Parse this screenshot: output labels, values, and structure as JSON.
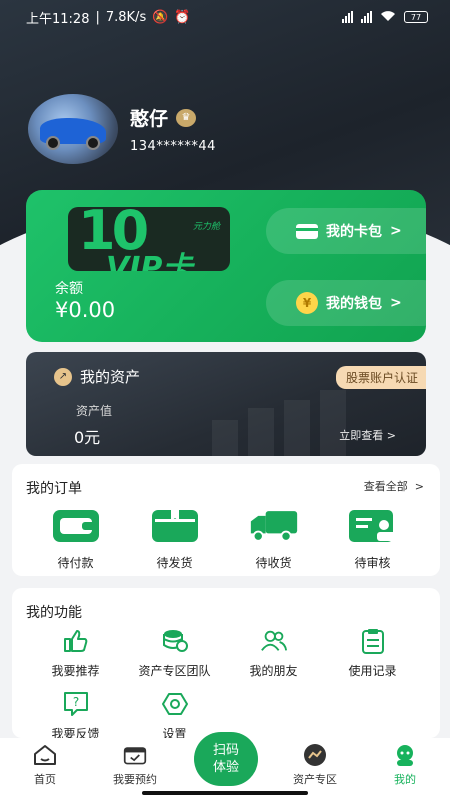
{
  "status_bar": {
    "time": "上午11:28",
    "speed": "7.8K/s",
    "network1": "4G",
    "network2": "4G",
    "battery": "77"
  },
  "profile": {
    "username": "憨仔",
    "phone": "134******44",
    "avatar_icon": "car-photo-avatar",
    "badge_icon": "vip-badge-icon"
  },
  "green_card": {
    "vip_big": "10",
    "vip_word": "VIP卡",
    "vip_brand": "元力舱",
    "balance_label": "余额",
    "balance_value": "¥0.00",
    "card_pack_label": "我的卡包",
    "wallet_label": "我的钱包",
    "coin_symbol": "¥",
    "arrow": ">"
  },
  "assets": {
    "title": "我的资产",
    "stock_tag": "股票账户认证",
    "value_label": "资产值",
    "value": "0元",
    "view_now": "立即查看 >"
  },
  "orders": {
    "title": "我的订单",
    "see_all": "查看全部",
    "see_all_arrow": ">",
    "items": [
      {
        "label": "待付款",
        "icon": "wallet-icon"
      },
      {
        "label": "待发货",
        "icon": "package-icon"
      },
      {
        "label": "待收货",
        "icon": "truck-icon"
      },
      {
        "label": "待审核",
        "icon": "id-card-icon"
      }
    ]
  },
  "functions": {
    "title": "我的功能",
    "items": [
      {
        "label": "我要推荐",
        "icon": "thumbs-up-icon"
      },
      {
        "label": "资产专区团队",
        "icon": "coins-icon"
      },
      {
        "label": "我的朋友",
        "icon": "friends-icon"
      },
      {
        "label": "使用记录",
        "icon": "clipboard-icon"
      },
      {
        "label": "我要反馈",
        "icon": "feedback-icon"
      },
      {
        "label": "设置",
        "icon": "gear-icon"
      }
    ]
  },
  "tabbar": {
    "items": [
      {
        "label": "首页",
        "icon": "home-icon"
      },
      {
        "label": "我要预约",
        "icon": "calendar-icon"
      },
      {
        "label": "资产专区",
        "icon": "asset-zone-icon"
      },
      {
        "label": "我的",
        "icon": "profile-icon"
      }
    ],
    "scan_line1": "扫码",
    "scan_line2": "体验",
    "active_color": "#17b25c"
  },
  "colors": {
    "brand_green": "#1aa85a",
    "dark_header": "#1d232b",
    "gold": "#f6d9b3"
  }
}
